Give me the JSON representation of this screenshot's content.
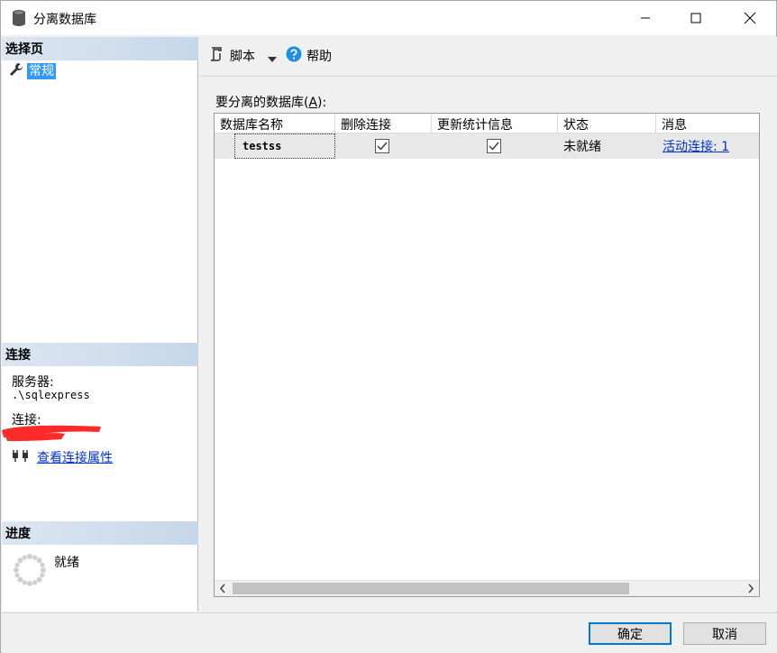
{
  "window": {
    "title": "分离数据库"
  },
  "left_panel": {
    "select_page_header": "选择页",
    "pages": [
      {
        "label": "常规",
        "icon": "wrench-icon",
        "selected": true
      }
    ],
    "connection_header": "连接",
    "server_label": "服务器:",
    "server_value": ".\\sqlexpress",
    "connection_label": "连接:",
    "view_connection_link": "查看连接属性",
    "progress_header": "进度",
    "progress_status": "就绪"
  },
  "toolbar": {
    "script_label": "脚本",
    "help_label": "帮助"
  },
  "main": {
    "db_list_label_prefix": "要分离的数据库(",
    "db_list_label_key": "A",
    "db_list_label_suffix": "):",
    "columns": [
      "数据库名称",
      "删除连接",
      "更新统计信息",
      "状态",
      "消息"
    ],
    "rows": [
      {
        "name": "testss",
        "drop_connections": true,
        "update_statistics": true,
        "status": "未就绪",
        "message": "活动连接: 1"
      }
    ]
  },
  "footer": {
    "ok_label": "确定",
    "cancel_label": "取消"
  },
  "colors": {
    "accent": "#0078d7",
    "selection": "#3399ff",
    "link": "#0033cc",
    "redaction": "#ff2a2a"
  }
}
